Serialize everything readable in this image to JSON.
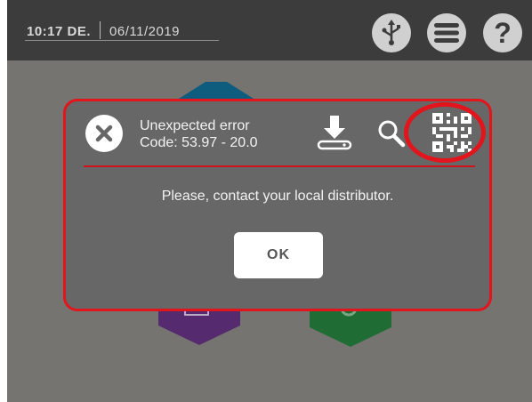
{
  "status": {
    "time": "10:17 DE.",
    "date": "06/11/2019"
  },
  "topbar_icons": [
    "usb-icon",
    "menu-icon",
    "help-icon"
  ],
  "dialog": {
    "title_line1": "Unexpected error",
    "title_line2": "Code: 53.97 - 20.0",
    "message": "Please, contact your local distributor.",
    "ok_label": "OK",
    "icons": [
      "close-icon",
      "download-icon",
      "search-icon",
      "qr-code-icon"
    ]
  },
  "colors": {
    "highlight": "#e2141c",
    "topbar": "#3c3c3c",
    "background": "#767470",
    "dialog": "#676767"
  }
}
